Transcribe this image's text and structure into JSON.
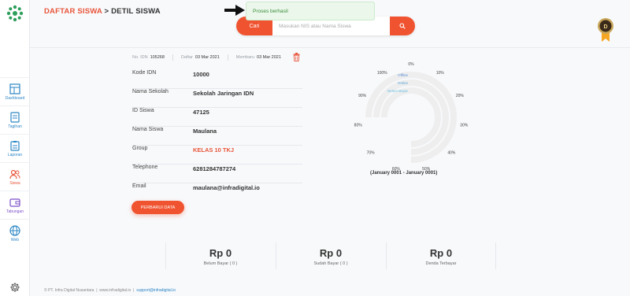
{
  "breadcrumb": {
    "section": "DAFTAR SISWA",
    "separator": " > ",
    "page": "DETIL SISWA"
  },
  "toast": {
    "message": "Proses berhasil"
  },
  "search": {
    "button_label": "Cari",
    "placeholder": "Masukan NIS atau Nama Siswa",
    "value": ""
  },
  "sidebar": {
    "items": [
      {
        "label": "Dashboard",
        "icon": "dashboard-icon"
      },
      {
        "label": "Tagihan",
        "icon": "invoice-icon"
      },
      {
        "label": "Laporan",
        "icon": "report-icon"
      },
      {
        "label": "Siswa",
        "icon": "students-icon",
        "active": true
      },
      {
        "label": "Tabungan",
        "icon": "wallet-icon"
      },
      {
        "label": "Web",
        "icon": "globe-icon"
      }
    ]
  },
  "meta": {
    "idn_label": "No. IDN",
    "idn_value": "105268",
    "daftar_label": "Daftar",
    "daftar_value": "03 Mar 2021",
    "update_label": "Membaru",
    "update_value": "03 Mar 2021"
  },
  "details": [
    {
      "label": "Kode IDN",
      "value": "10000"
    },
    {
      "label": "Nama Sekolah",
      "value": "Sekolah Jaringan IDN"
    },
    {
      "label": "ID Siswa",
      "value": "47125"
    },
    {
      "label": "Nama Siswa",
      "value": "Maulana"
    },
    {
      "label": "Group",
      "value": "KELAS 10 TKJ"
    },
    {
      "label": "Telephone",
      "value": "6281284787274"
    },
    {
      "label": "Email",
      "value": "maulana@infradigital.io"
    }
  ],
  "update_button": "PERBARUI DATA",
  "chart_data": {
    "type": "radial-bar",
    "series": [
      {
        "name": "Offline",
        "value": 0,
        "color": "#5b8fd6"
      },
      {
        "name": "Online",
        "value": 0,
        "color": "#5aa9d6"
      },
      {
        "name": "Belum Bayar",
        "value": 0,
        "color": "#6cc0e0"
      }
    ],
    "ticks": [
      "0%",
      "10%",
      "20%",
      "30%",
      "40%",
      "50%",
      "60%",
      "70%",
      "80%",
      "90%",
      "100%"
    ],
    "period": "(January 0001 - January 0001)"
  },
  "summary": [
    {
      "amount": "Rp 0",
      "caption": "Belum Bayar ( 0 )"
    },
    {
      "amount": "Rp 0",
      "caption": "Sudah Bayar ( 0 )"
    },
    {
      "amount": "Rp 0",
      "caption": "Denda Terbayar"
    }
  ],
  "footer": {
    "company": "© PT. Infra Digital Nusantara",
    "site": "www.infradigital.io",
    "email": "support@infradigital.io"
  },
  "colors": {
    "accent": "#f0532f",
    "link": "#2b86c5",
    "success_bg": "#eaf7ea"
  }
}
